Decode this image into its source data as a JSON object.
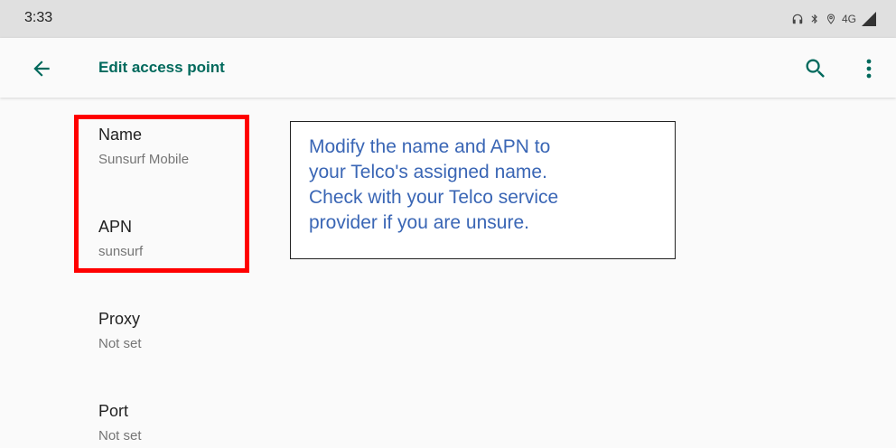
{
  "status_bar": {
    "time": "3:33",
    "network_label": "4G",
    "icons": [
      "headset-icon",
      "bluetooth-icon",
      "location-icon",
      "signal-icon"
    ]
  },
  "app_bar": {
    "title": "Edit access point",
    "icons": [
      "back-arrow-icon",
      "search-icon",
      "more-vert-icon"
    ],
    "accent_color": "#00695c"
  },
  "preferences": [
    {
      "title": "Name",
      "summary": "Sunsurf Mobile"
    },
    {
      "title": "APN",
      "summary": "sunsurf"
    },
    {
      "title": "Proxy",
      "summary": "Not set"
    },
    {
      "title": "Port",
      "summary": "Not set"
    }
  ],
  "annotation": {
    "highlight_color": "#ff0000",
    "callout_text": "Modify the name and APN to\nyour Telco's assigned name.\nCheck with your Telco service\nprovider if you are unsure.",
    "callout_text_color": "#3a66b5"
  }
}
